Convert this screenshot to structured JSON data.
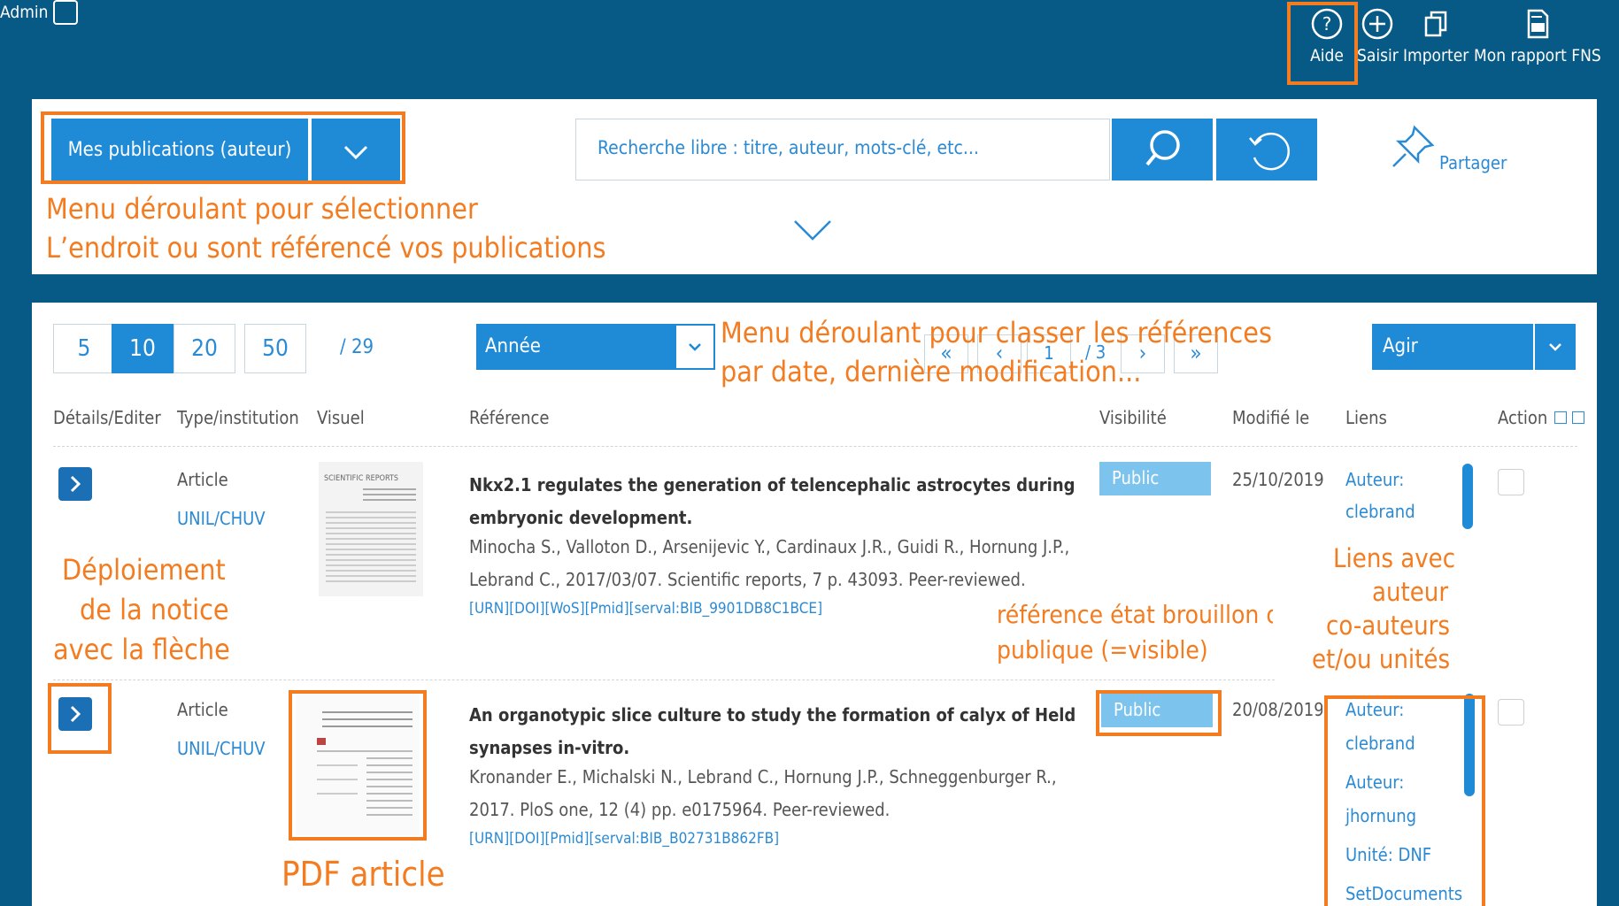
{
  "topbar": {
    "admin_label": "Admin",
    "buttons": [
      {
        "label": "Aide",
        "icon": "help-icon"
      },
      {
        "label": "Saisir",
        "icon": "plus-icon"
      },
      {
        "label": "Importer",
        "icon": "copy-icon"
      },
      {
        "label": "Mon rapport FNS",
        "icon": "report-icon"
      }
    ]
  },
  "search_panel": {
    "dropdown_label": "Mes publications (auteur)",
    "search_placeholder": "Recherche libre : titre, auteur, mots-clé, etc...",
    "share_label": "Partager"
  },
  "list_controls": {
    "page_sizes": [
      "5",
      "10",
      "20",
      "50"
    ],
    "active_page_size": "10",
    "total": "/ 29",
    "sort_label": "Année",
    "page_current": "1",
    "page_total": "/ 3",
    "action_label": "Agir"
  },
  "columns": [
    "Détails/Editer",
    "Type/institution",
    "Visuel",
    "Référence",
    "Visibilité",
    "Modifié le",
    "Liens",
    "Action"
  ],
  "rows": [
    {
      "type": "Article",
      "institution": "UNIL/CHUV",
      "thumb_header": "SCIENTIFIC REPORTS",
      "title": "Nkx2.1 regulates the generation of telencephalic astrocytes during embryonic development.",
      "authors": "Minocha S., Valloton D., Arsenijevic Y., Cardinaux J.R., Guidi R., Hornung J.P., Lebrand C., 2017/03/07. Scientific reports, 7 p. 43093. Peer-reviewed.",
      "ids": "[URN][DOI][WoS][Pmid][serval:BIB_9901DB8C1BCE]",
      "visibility": "Public",
      "modified": "25/10/2019",
      "links": [
        "Auteur:",
        "clebrand"
      ]
    },
    {
      "type": "Article",
      "institution": "UNIL/CHUV",
      "title": "An organotypic slice culture to study the formation of calyx of Held synapses in-vitro.",
      "authors": "Kronander E., Michalski N., Lebrand C., Hornung J.P., Schneggenburger R., 2017. PloS one, 12 (4) pp. e0175964. Peer-reviewed.",
      "ids": "[URN][DOI][Pmid][serval:BIB_B02731B862FB]",
      "visibility": "Public",
      "modified": "20/08/2019",
      "links": [
        "Auteur:",
        "clebrand",
        "Auteur:",
        "jhornung",
        "Unité: DNF",
        "SetDocuments"
      ]
    }
  ],
  "annotations": {
    "dropdown_note_1": "Menu déroulant pour sélectionner",
    "dropdown_note_2": "L’endroit ou sont référencé vos publications",
    "sort_note_1": "Menu  déroulant  pour  classer  les  références",
    "sort_note_2": "par date, dernière modification...",
    "deploy_1": "Déploiement",
    "deploy_2": "de la notice",
    "deploy_3": "avec la flèche",
    "visibility_1": "référence état brouillon ou",
    "visibility_2": "publique (=visible)",
    "links_1": "Liens avec",
    "links_2": "auteur",
    "links_3": "co-auteurs",
    "links_4": "et/ou unités",
    "pdf": "PDF article"
  }
}
